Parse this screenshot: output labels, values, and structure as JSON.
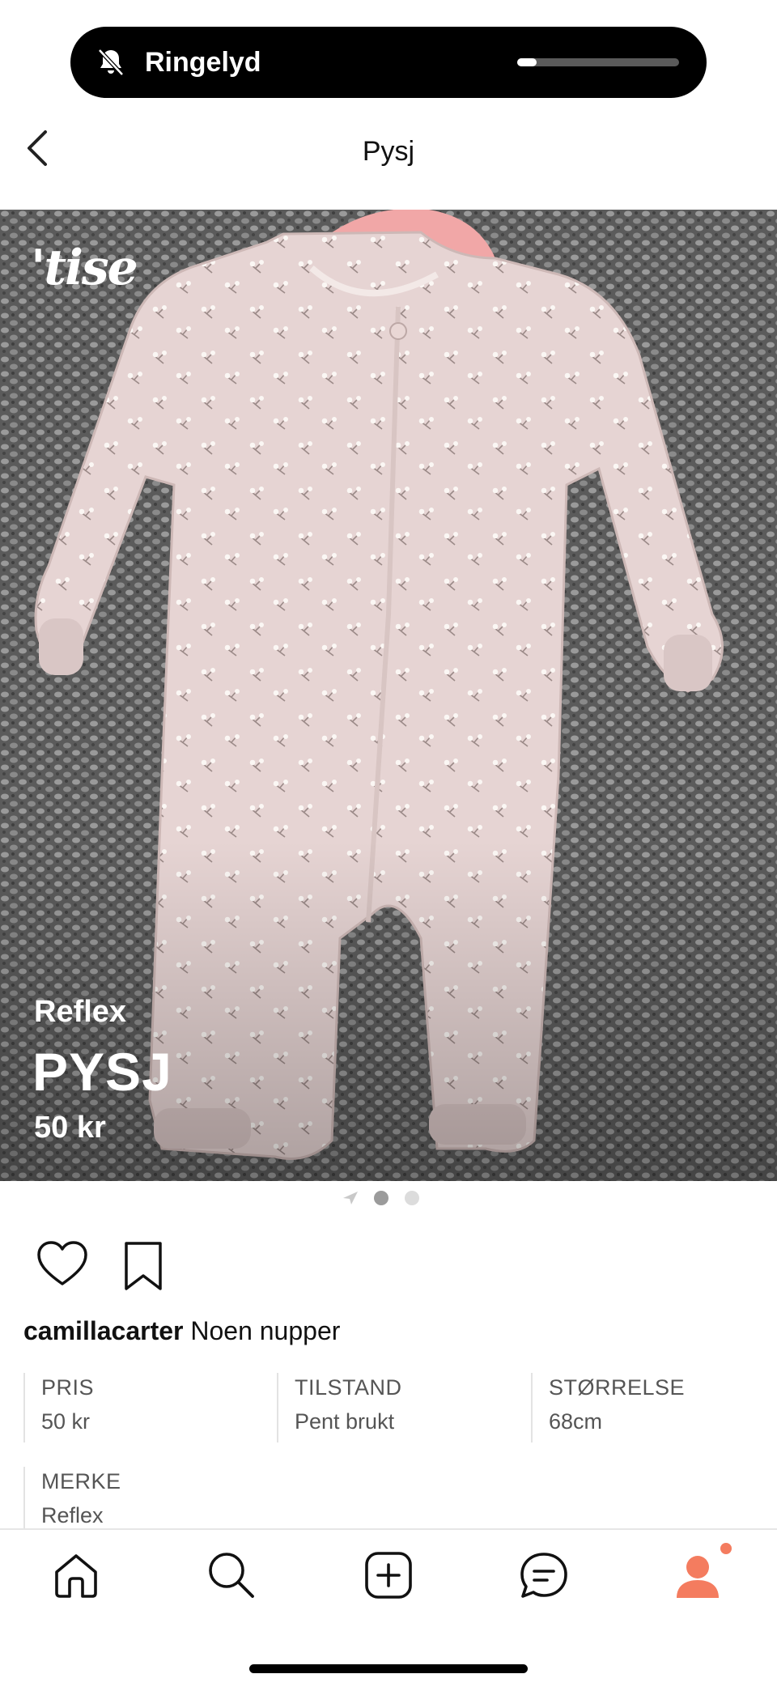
{
  "status": {
    "ringer_label": "Ringelyd",
    "volume_level": 0.12
  },
  "header": {
    "title": "Pysj"
  },
  "listing": {
    "logo_text": "'tise",
    "brand": "Reflex",
    "name": "PYSJ",
    "price": "50 kr",
    "image_count": 2,
    "current_image": 1
  },
  "caption": {
    "username": "camillacarter",
    "text": "Noen nupper"
  },
  "details": [
    {
      "key": "PRIS",
      "value": "50 kr"
    },
    {
      "key": "TILSTAND",
      "value": "Pent brukt"
    },
    {
      "key": "STØRRELSE",
      "value": "68cm"
    },
    {
      "key": "MERKE",
      "value": "Reflex"
    }
  ],
  "nav": {
    "items": [
      "home-icon",
      "search-icon",
      "add-icon",
      "messages-icon",
      "profile-icon"
    ],
    "accent": "#f47c5f"
  }
}
